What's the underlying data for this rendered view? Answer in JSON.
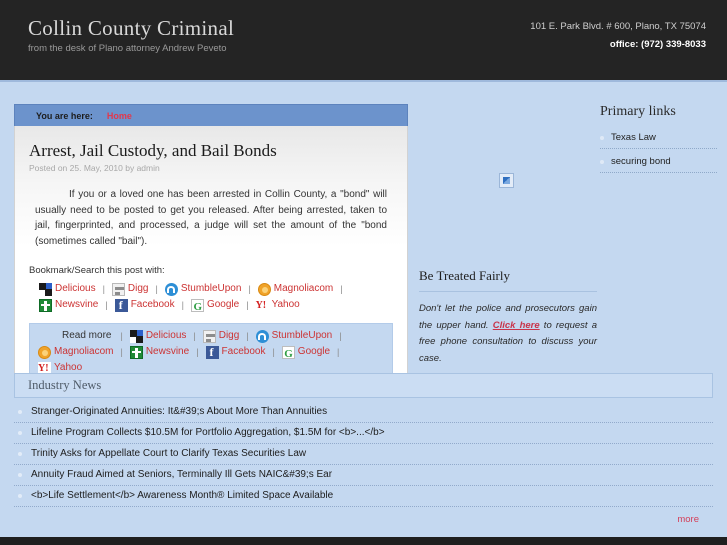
{
  "header": {
    "brand_title": "Collin County Criminal",
    "brand_subtitle": "from the desk of Plano attorney Andrew Peveto",
    "address": "101 E. Park Blvd. # 600, Plano, TX 75074",
    "phone": "office: (972) 339-8033"
  },
  "breadcrumb": {
    "label": "You are here:",
    "link": "Home"
  },
  "article": {
    "title": "Arrest, Jail Custody, and Bail Bonds",
    "meta": "Posted on 25. May, 2010 by admin",
    "body": "If you or a loved one has been arrested in Collin County, a \"bond\" will usually need to be posted to get you released.  After being arrested, taken to jail, fingerprinted, and processed, a judge will set the amount of the \"bond (sometimes called \"bail\").",
    "bookmark_label": "Bookmark/Search this post with:",
    "read_more_label": "Read more",
    "share_services": [
      {
        "name": "Delicious",
        "icon": "delicious-icon"
      },
      {
        "name": "Digg",
        "icon": "digg-icon"
      },
      {
        "name": "StumbleUpon",
        "icon": "stumbleupon-icon"
      },
      {
        "name": "Magnoliacom",
        "icon": "magnolia-icon"
      },
      {
        "name": "Newsvine",
        "icon": "newsvine-icon"
      },
      {
        "name": "Facebook",
        "icon": "facebook-icon"
      },
      {
        "name": "Google",
        "icon": "google-icon"
      },
      {
        "name": "Yahoo",
        "icon": "yahoo-icon"
      }
    ]
  },
  "sidebar": {
    "title": "Primary links",
    "items": [
      {
        "label": "Texas Law"
      },
      {
        "label": "securing bond"
      }
    ]
  },
  "fairly": {
    "title": "Be Treated Fairly",
    "text_before": "Don't let the police and prosecutors gain the upper hand. ",
    "link": "Click here",
    "text_after": " to request a free phone consultation to discuss your case."
  },
  "news": {
    "title": "Industry News",
    "more_label": "more",
    "items": [
      {
        "label": "Stranger-Originated Annuities: It&#39;s About More Than Annuities"
      },
      {
        "label": "Lifeline Program Collects $10.5M for Portfolio Aggregation, $1.5M for <b>...</b>"
      },
      {
        "label": "Trinity Asks for Appellate Court to Clarify Texas Securities Law"
      },
      {
        "label": "Annuity Fraud Aimed at Seniors, Terminally Ill Gets NAIC&#39;s Ear"
      },
      {
        "label": "<b>Life Settlement</b> Awareness Month® Limited Space Available"
      }
    ]
  },
  "colors": {
    "page_bg": "#c4d8f0",
    "header_bg": "#242424",
    "breadcrumb_bg": "#6c93cc",
    "accent_red": "#cc3333",
    "link_red": "#d4405a"
  }
}
